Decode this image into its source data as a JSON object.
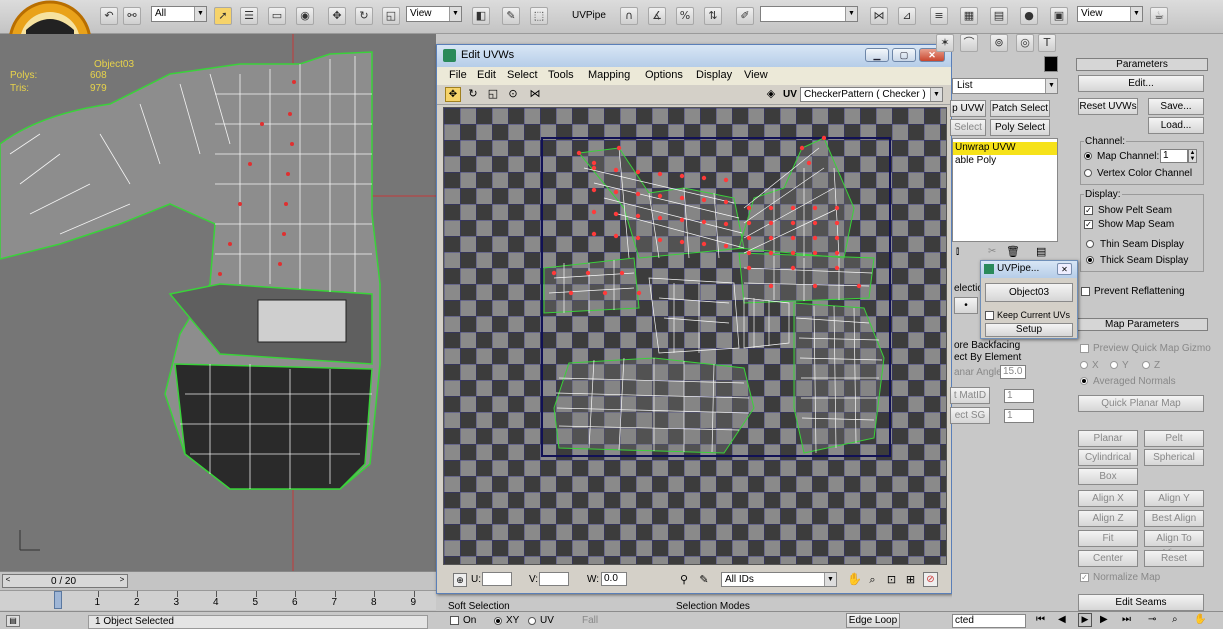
{
  "toolbar": {
    "filter_select": "All",
    "view_select": "View",
    "named_selection": "UVPipe",
    "view_select_right": "View"
  },
  "viewport": {
    "object_label": "Object03",
    "polys_label": "Polys:",
    "polys_value": "608",
    "tris_label": "Tris:",
    "tris_value": "979"
  },
  "timeline": {
    "frame_counter": "0 / 20",
    "ticks": [
      "0",
      "1",
      "2",
      "3",
      "4",
      "5",
      "6",
      "7",
      "8",
      "9"
    ]
  },
  "statusbar": {
    "selection_status": "1 Object Selected",
    "soft_selection": "Soft Selection",
    "on_label": "On",
    "xy_label": "XY",
    "uv_label": "UV",
    "fall_label": "Fall",
    "selection_modes": "Selection Modes",
    "edge_loop": "Edge Loop",
    "selected_label": "cted"
  },
  "uvw_editor": {
    "title": "Edit UVWs",
    "menu": [
      "File",
      "Edit",
      "Select",
      "Tools",
      "Mapping",
      "Options",
      "Display",
      "View"
    ],
    "uv_label": "UV",
    "texture_select": "CheckerPattern  ( Checker )",
    "u_label": "U:",
    "v_label": "V:",
    "w_label": "W:",
    "w_value": "0.0",
    "ids_select": "All IDs"
  },
  "command_panel": {
    "modifier_list": "List",
    "unwrap_uvw_btn": "p UVW",
    "patch_select_btn": "Patch Select",
    "select_btn": "Select",
    "poly_select_btn": "Poly Select",
    "stack_item_1": "Unwrap UVW",
    "stack_item_2": "able Poly",
    "parameters_hdr": "Parameters",
    "edit_btn": "Edit...",
    "reset_uvws_btn": "Reset UVWs",
    "save_btn": "Save...",
    "load_btn": "Load...",
    "channel_lbl": "Channel:",
    "map_channel_lbl": "Map Channel:",
    "map_channel_value": "1",
    "vertex_color_lbl": "Vertex Color Channel",
    "display_lbl": "Display:",
    "show_pelt_seam": "Show Pelt Seam",
    "show_map_seam": "Show Map Seam",
    "thin_seam": "Thin Seam Display",
    "thick_seam": "Thick Seam Display",
    "prevent_reflattening": "Prevent Reflattening",
    "map_params_hdr": "Map Parameters",
    "preview_gizmo": "Preview Quick Map Gizmo",
    "axis_x": "X",
    "axis_y": "Y",
    "axis_z": "Z",
    "averaged_normals": "Averaged Normals",
    "quick_planar_map": "Quick Planar Map",
    "planar": "Planar",
    "pelt": "Pelt",
    "cylindrical": "Cylindrical",
    "spherical": "Spherical",
    "box": "Box",
    "align_x": "Align X",
    "align_y": "Align Y",
    "align_z": "Align Z",
    "best_align": "Best Align",
    "fit": "Fit",
    "align_to_view": "Align To View",
    "center": "Center",
    "reset": "Reset",
    "normalize_map": "Normalize Map",
    "edit_seams": "Edit Seams",
    "selection_hdr": "election",
    "ignore_backfacing": "ore Backfacing",
    "select_by_element": "ect By Element",
    "planar_angle": "anar Angle",
    "planar_angle_value": "15.0",
    "set_matid": "t MatID",
    "matid_value": "1",
    "select_sg": "ect SG",
    "sg_value": "1"
  },
  "uvpipe": {
    "title": "UVPipe...",
    "object_btn": "Object03",
    "keep_current_uvs": "Keep Current UVs",
    "setup_btn": "Setup"
  }
}
